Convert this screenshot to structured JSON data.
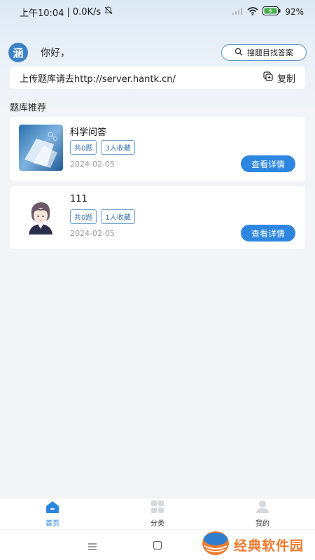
{
  "status_bar": {
    "time": "上午10:04",
    "network_speed": "0.0K/s",
    "battery": "92%"
  },
  "header": {
    "avatar_char": "涵",
    "greeting": "你好，",
    "search_label": "搜题目找答案"
  },
  "upload": {
    "text": "上传题库请去http://server.hantk.cn/",
    "copy_label": "复制"
  },
  "section_title": "题库推荐",
  "banks": [
    {
      "name": "科学问答",
      "questions": "共0题",
      "favorites": "3人收藏",
      "date": "2024-02-05",
      "detail_label": "查看详情"
    },
    {
      "name": "111",
      "questions": "共0题",
      "favorites": "1人收藏",
      "date": "2024-02-05",
      "detail_label": "查看详情"
    }
  ],
  "tabs": [
    {
      "label": "首页",
      "icon": "home-icon",
      "active": true
    },
    {
      "label": "分类",
      "icon": "grid-icon",
      "active": false
    },
    {
      "label": "我的",
      "icon": "user-icon",
      "active": false
    }
  ],
  "watermark": "经典软件园",
  "colors": {
    "accent": "#2d86e0",
    "tag_border": "#6e9fd0",
    "watermark": "#f07a2e"
  }
}
